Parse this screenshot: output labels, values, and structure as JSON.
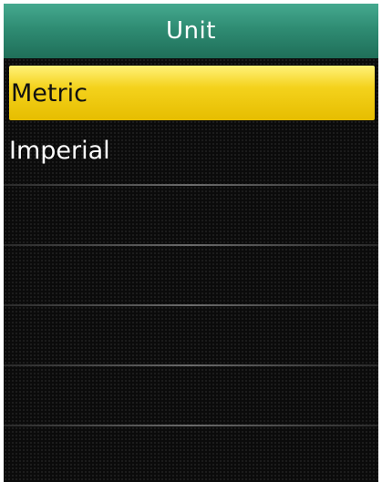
{
  "header": {
    "title": "Unit"
  },
  "menu": {
    "items": [
      {
        "label": "Metric",
        "selected": true
      },
      {
        "label": "Imperial",
        "selected": false
      }
    ]
  },
  "colors": {
    "header_green": "#2f8c73",
    "selection_yellow": "#f4d21c",
    "background": "#0b0b0b"
  }
}
